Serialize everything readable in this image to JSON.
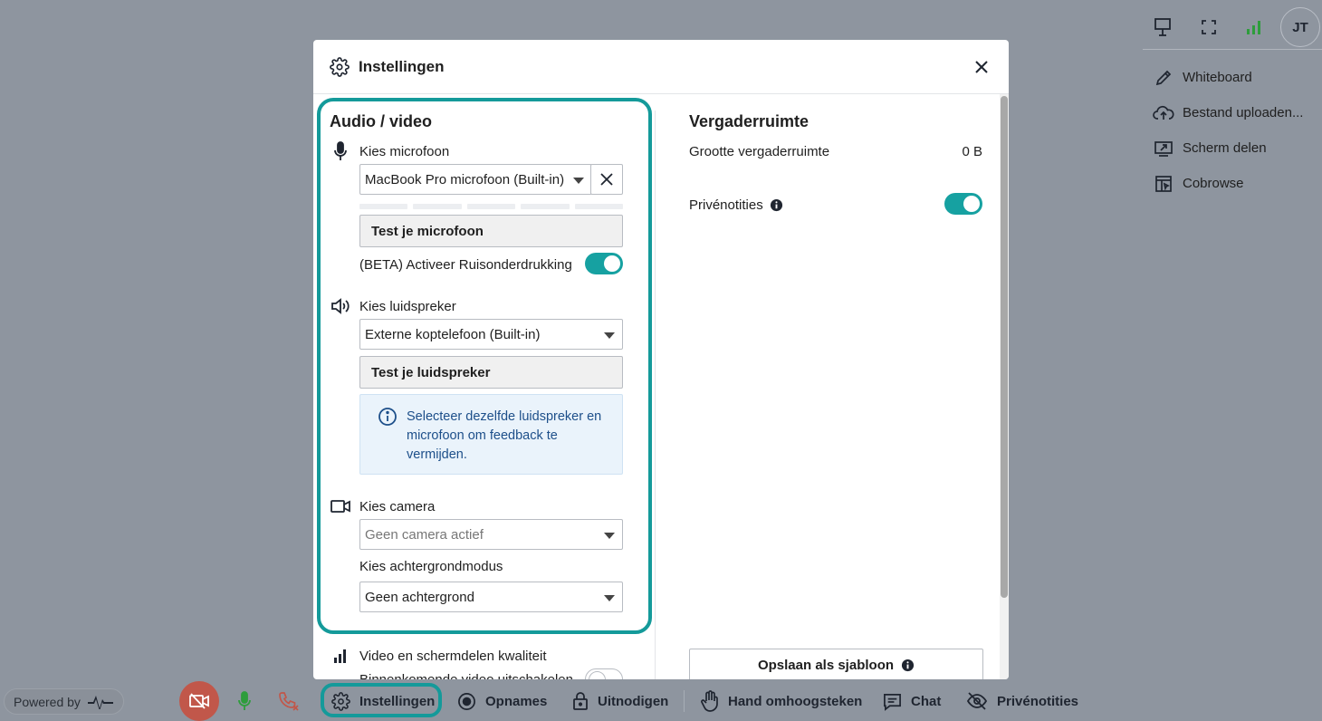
{
  "top_right": {
    "avatar_initials": "JT",
    "icons": [
      "presentation-icon",
      "fullscreen-icon",
      "signal-icon"
    ]
  },
  "side_menu": [
    {
      "label": "Whiteboard",
      "icon": "pencil-icon"
    },
    {
      "label": "Bestand uploaden...",
      "icon": "cloud-upload-icon"
    },
    {
      "label": "Scherm delen",
      "icon": "screen-share-icon"
    },
    {
      "label": "Cobrowse",
      "icon": "cobrowse-icon"
    }
  ],
  "modal": {
    "title": "Instellingen",
    "left": {
      "section_title": "Audio / video",
      "mic_label": "Kies microfoon",
      "mic_value": "MacBook Pro microfoon (Built-in)",
      "test_mic": "Test je microfoon",
      "noise_label": "(BETA) Activeer Ruisonderdrukking",
      "speaker_label": "Kies luidspreker",
      "speaker_value": "Externe koptelefoon (Built-in)",
      "test_speaker": "Test je luidspreker",
      "info_text": "Selecteer dezelfde luidspreker en microfoon om feedback te vermijden.",
      "camera_label": "Kies camera",
      "camera_value": "Geen camera actief",
      "bg_label": "Kies achtergrondmodus",
      "bg_value": "Geen achtergrond",
      "quality_label": "Video en schermdelen kwaliteit",
      "incoming_label": "Binnenkomende video uitschakelen"
    },
    "right": {
      "section_title": "Vergaderruimte",
      "size_label": "Grootte vergaderruimte",
      "size_value": "0 B",
      "notes_label": "Privénotities",
      "save_template": "Opslaan als sjabloon"
    }
  },
  "bottom_bar": {
    "powered_by": "Powered by",
    "settings": "Instellingen",
    "recordings": "Opnames",
    "invite": "Uitnodigen",
    "raise_hand": "Hand omhoogsteken",
    "chat": "Chat",
    "private_notes": "Privénotities"
  },
  "colors": {
    "accent": "#149a9a",
    "toggle_on": "#16a1a1",
    "backdrop": "#8e959f",
    "info_bg": "#eaf3fb",
    "info_text": "#1d4f8a",
    "camera_off": "#c1574a",
    "mic_green": "#2e9d3c"
  }
}
